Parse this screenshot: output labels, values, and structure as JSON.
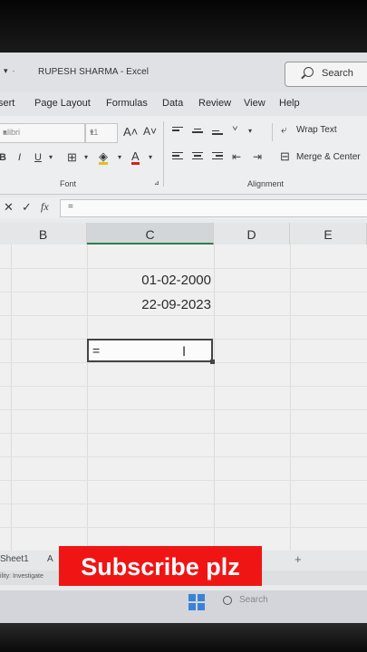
{
  "window": {
    "title": "RUPESH SHARMA  -  Excel",
    "search_label": "Search"
  },
  "menu": {
    "items": [
      "sert",
      "Page Layout",
      "Formulas",
      "Data",
      "Review",
      "View",
      "Help"
    ]
  },
  "ribbon": {
    "font_name": "alibri",
    "font_size": "11",
    "grow_font": "A˄",
    "shrink_font": "A˅",
    "bold": "B",
    "italic": "I",
    "underline": "U",
    "font_color": "A",
    "font_group_label": "Font",
    "alignment_group_label": "Alignment",
    "wrap_text": "Wrap Text",
    "merge_center": "Merge & Center"
  },
  "formula_bar": {
    "cancel": "✕",
    "enter": "✓",
    "fx": "fx",
    "content": "="
  },
  "columns": [
    "B",
    "C",
    "D",
    "E"
  ],
  "cells": {
    "c_row1": "01-02-2000",
    "c_row2": "22-09-2023",
    "active_cell_text": "="
  },
  "sheets": {
    "tab": "Sheet1",
    "partial": "A"
  },
  "status": {
    "text": "ility: Investigate"
  },
  "taskbar": {
    "search_placeholder": "Search"
  },
  "overlay": {
    "subscribe_text": "Subscribe plz",
    "color": "#f01515"
  },
  "colors": {
    "selected_header_accent": "#2e7d4f",
    "windows_logo": "#3b82d6"
  }
}
